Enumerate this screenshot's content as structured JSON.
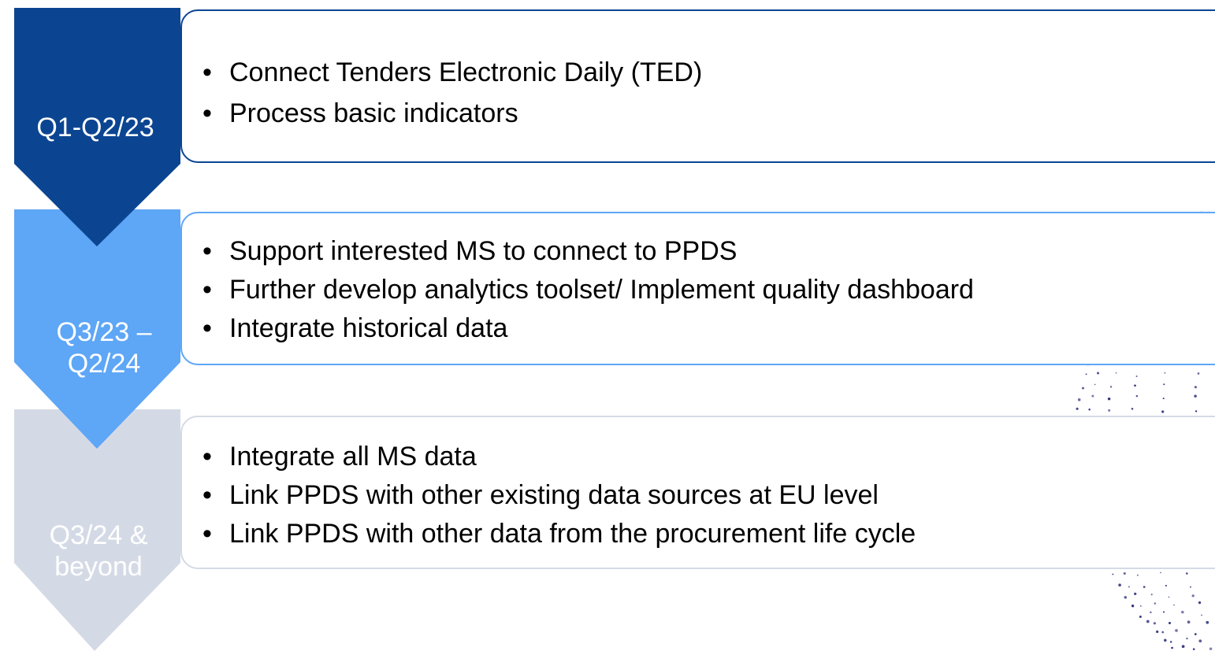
{
  "steps": [
    {
      "label": "Q1-Q2/23",
      "items": [
        "Connect Tenders Electronic Daily (TED)",
        "Process basic indicators"
      ]
    },
    {
      "label_lines": [
        "Q3/23 –",
        "Q2/24"
      ],
      "items": [
        "Support interested MS to connect to PPDS",
        "Further develop analytics toolset/ Implement quality dashboard",
        "Integrate historical data"
      ]
    },
    {
      "label_lines": [
        "Q3/24 &",
        "beyond"
      ],
      "items": [
        "Integrate all MS data",
        "Link PPDS with other existing data sources at EU level",
        "Link PPDS with other data from the procurement life cycle"
      ]
    }
  ],
  "colors": {
    "step1": "#0b4592",
    "step2": "#5ea6f6",
    "step3": "#d4dae5",
    "dots": "#2c2f7a"
  }
}
